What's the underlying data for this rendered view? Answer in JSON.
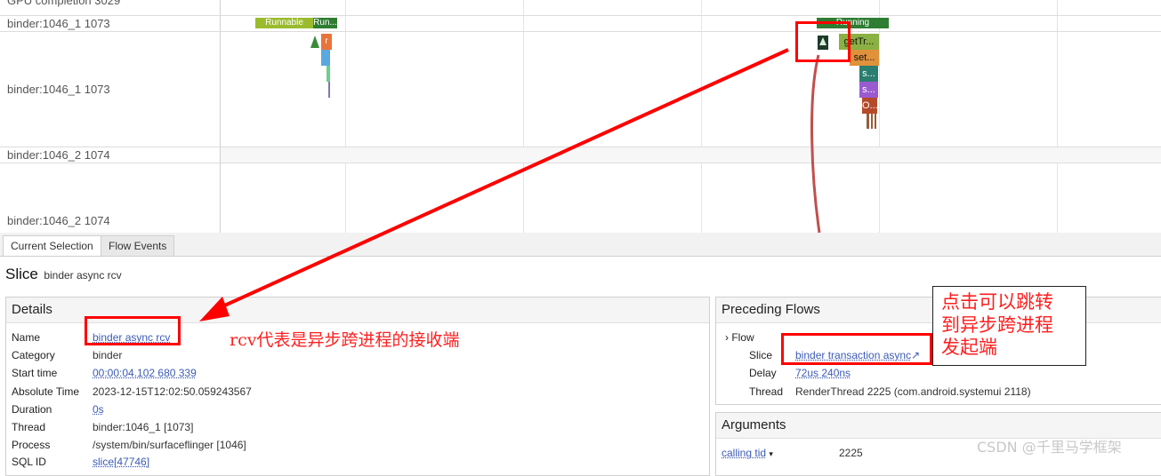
{
  "timeline": {
    "tracks": [
      "GPU completion 3029",
      "binder:1046_1 1073",
      "binder:1046_1 1073",
      "binder:1046_2 1074",
      "binder:1046_2 1074"
    ],
    "slices": {
      "runnable": "Runnable",
      "run_short": "Run...",
      "r_label": "r",
      "running": "Running",
      "gettr": "getTr...",
      "set": "set...",
      "s1": "s...",
      "s2": "s...",
      "o": "O..."
    }
  },
  "tabs": [
    "Current Selection",
    "Flow Events"
  ],
  "slice_header": {
    "kind": "Slice",
    "name": "binder async rcv"
  },
  "details": {
    "title": "Details",
    "rows": [
      {
        "key": "Name",
        "value": "binder async rcv"
      },
      {
        "key": "Category",
        "value": "binder"
      },
      {
        "key": "Start time",
        "value": "00:00:04.102 680 339"
      },
      {
        "key": "Absolute Time",
        "value": "2023-12-15T12:02:50.059243567"
      },
      {
        "key": "Duration",
        "value": "0s"
      },
      {
        "key": "Thread",
        "value": "binder:1046_1 [1073]"
      },
      {
        "key": "Process",
        "value": "/system/bin/surfaceflinger [1046]"
      },
      {
        "key": "SQL ID",
        "value": "slice[47746]"
      }
    ]
  },
  "preceding_flows": {
    "title": "Preceding Flows",
    "flow_label": "Flow",
    "rows": [
      {
        "key": "Slice",
        "value": "binder transaction async",
        "link_icon": "↗"
      },
      {
        "key": "Delay",
        "value": "72us 240ns"
      },
      {
        "key": "Thread",
        "value": "RenderThread 2225 (com.android.systemui 2118)"
      }
    ]
  },
  "arguments": {
    "title": "Arguments",
    "rows": [
      {
        "key": "calling tid",
        "value": "2225"
      }
    ]
  },
  "annotations": {
    "left_note": "rcv代表是异步跨进程的接收端",
    "right_note_lines": [
      "点击可以跳转",
      "到异步跨进程",
      "发起端"
    ]
  },
  "watermark": "CSDN @千里马学框架",
  "colors": {
    "runnable": "#9bbb2e",
    "running": "#2e7d32",
    "annotation_red": "#ff0000",
    "link_blue": "#3b5bb5"
  }
}
